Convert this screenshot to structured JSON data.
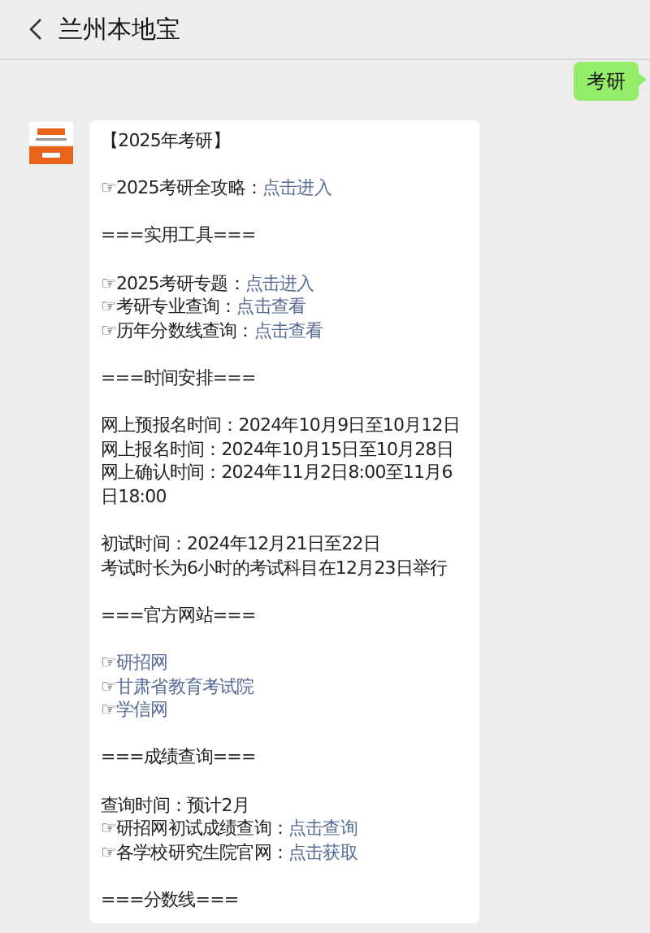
{
  "header": {
    "title": "兰州本地宝"
  },
  "sent_message": {
    "text": "考研"
  },
  "received_message": {
    "lines": [
      {
        "kind": "text",
        "text": "【2025年考研】"
      },
      {
        "kind": "gap"
      },
      {
        "kind": "text",
        "text": "☞2025考研全攻略：",
        "link": "点击进入"
      },
      {
        "kind": "gap"
      },
      {
        "kind": "text",
        "text": "===实用工具==="
      },
      {
        "kind": "gap"
      },
      {
        "kind": "text",
        "text": "☞2025考研专题：",
        "link": "点击进入"
      },
      {
        "kind": "text",
        "text": "☞考研专业查询：",
        "link": "点击查看"
      },
      {
        "kind": "text",
        "text": "☞历年分数线查询：",
        "link": "点击查看"
      },
      {
        "kind": "gap"
      },
      {
        "kind": "text",
        "text": "===时间安排==="
      },
      {
        "kind": "gap"
      },
      {
        "kind": "text",
        "text": "网上预报名时间：2024年10月9日至10月12日"
      },
      {
        "kind": "text",
        "text": "网上报名时间：2024年10月15日至10月28日"
      },
      {
        "kind": "text",
        "text": "网上确认时间：2024年11月2日8:00至11月6日18:00"
      },
      {
        "kind": "gap"
      },
      {
        "kind": "text",
        "text": "初试时间：2024年12月21日至22日"
      },
      {
        "kind": "text",
        "text": "考试时长为6小时的考试科目在12月23日举行"
      },
      {
        "kind": "gap"
      },
      {
        "kind": "text",
        "text": "===官方网站==="
      },
      {
        "kind": "gap"
      },
      {
        "kind": "text",
        "text": "☞",
        "link": "研招网"
      },
      {
        "kind": "text",
        "text": "☞",
        "link": "甘肃省教育考试院"
      },
      {
        "kind": "text",
        "text": "☞",
        "link": "学信网"
      },
      {
        "kind": "gap"
      },
      {
        "kind": "text",
        "text": "===成绩查询==="
      },
      {
        "kind": "gap"
      },
      {
        "kind": "text",
        "text": "查询时间：预计2月"
      },
      {
        "kind": "text",
        "text": "☞研招网初试成绩查询：",
        "link": "点击查询"
      },
      {
        "kind": "text",
        "text": "☞各学校研究生院官网：",
        "link": "点击获取"
      },
      {
        "kind": "gap"
      },
      {
        "kind": "text",
        "text": "===分数线==="
      }
    ]
  }
}
